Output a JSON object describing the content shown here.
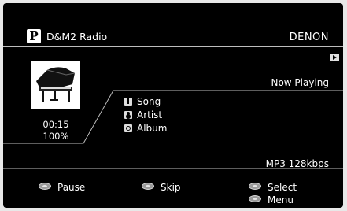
{
  "header": {
    "source_icon": "P",
    "source_name": "D&M2 Radio",
    "brand": "DENON"
  },
  "play_indicator_icon": "play-icon",
  "now_playing_label": "Now Playing",
  "track": {
    "elapsed": "00:15",
    "buffer": "100%",
    "fields": [
      {
        "icon": "note-icon",
        "label": "Song"
      },
      {
        "icon": "artist-icon",
        "label": "Artist"
      },
      {
        "icon": "album-icon",
        "label": "Album"
      }
    ]
  },
  "format": "MP3 128kbps",
  "footer": {
    "pause": "Pause",
    "skip": "Skip",
    "select": "Select",
    "menu": "Menu"
  },
  "colors": {
    "screen_bg": "#000000",
    "text": "#ffffff",
    "frame": "#e8e8e8",
    "rule": "#bdbdbd"
  }
}
